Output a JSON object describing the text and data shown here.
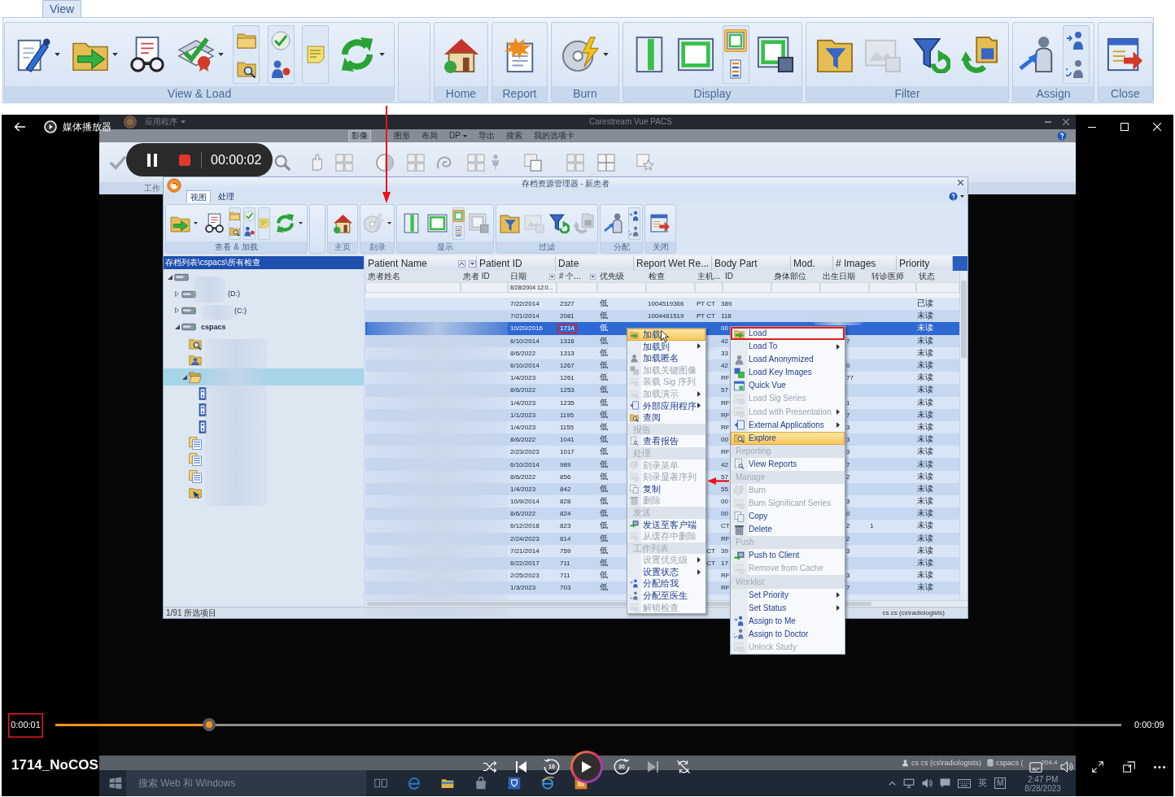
{
  "ribbon": {
    "tabs": [
      {
        "label": "View",
        "selected": true
      }
    ],
    "groups": [
      {
        "kind": "group",
        "label": "View & Load",
        "buttons": [
          {
            "kind": "large",
            "dropdown": true,
            "disabled": false
          },
          {
            "kind": "large",
            "dropdown": true,
            "disabled": false
          },
          {
            "kind": "large",
            "dropdown": false,
            "disabled": false
          },
          {
            "kind": "large",
            "dropdown": true,
            "disabled": false
          },
          {
            "kind": "stack",
            "buttons": [
              {
                "selected": false,
                "disabled": false
              },
              {
                "selected": false,
                "disabled": false
              }
            ]
          },
          {
            "kind": "stack",
            "buttons": [
              {
                "selected": false,
                "disabled": false
              },
              {
                "selected": false,
                "disabled": false
              }
            ]
          },
          {
            "kind": "stack",
            "buttons": [
              {
                "selected": false,
                "disabled": false
              }
            ]
          },
          {
            "kind": "large",
            "dropdown": true,
            "disabled": false
          }
        ]
      },
      {
        "kind": "spacer"
      },
      {
        "kind": "group",
        "label": "Home",
        "buttons": [
          {
            "kind": "large",
            "dropdown": false,
            "disabled": false
          }
        ]
      },
      {
        "kind": "group",
        "label": "Report",
        "buttons": [
          {
            "kind": "large",
            "dropdown": false,
            "disabled": false
          }
        ]
      },
      {
        "kind": "group",
        "label": "Burn",
        "buttons": [
          {
            "kind": "large",
            "dropdown": true,
            "disabled": false
          }
        ]
      },
      {
        "kind": "group",
        "label": "Display",
        "buttons": [
          {
            "kind": "large",
            "dropdown": false,
            "disabled": false
          },
          {
            "kind": "large",
            "dropdown": false,
            "disabled": false
          },
          {
            "kind": "stack",
            "buttons": [
              {
                "selected": true,
                "disabled": false
              },
              {
                "selected": false,
                "disabled": false
              }
            ]
          },
          {
            "kind": "large",
            "dropdown": false,
            "disabled": false
          }
        ]
      },
      {
        "kind": "group",
        "label": "Filter",
        "buttons": [
          {
            "kind": "large",
            "dropdown": false,
            "disabled": false
          },
          {
            "kind": "large",
            "dropdown": false,
            "disabled": true
          },
          {
            "kind": "large",
            "dropdown": false,
            "disabled": false
          },
          {
            "kind": "large",
            "dropdown": false,
            "disabled": false
          }
        ]
      },
      {
        "kind": "group",
        "label": "Assign",
        "buttons": [
          {
            "kind": "large",
            "dropdown": false,
            "disabled": false
          },
          {
            "kind": "stack",
            "buttons": [
              {
                "selected": false,
                "disabled": false
              },
              {
                "selected": false,
                "disabled": false
              }
            ]
          }
        ]
      },
      {
        "kind": "group",
        "label": "Close",
        "buttons": [
          {
            "kind": "large",
            "dropdown": false,
            "disabled": false
          }
        ]
      }
    ]
  },
  "annotation_arrows": [
    {
      "kind": "down"
    },
    {
      "kind": "left"
    }
  ],
  "player": {
    "title": "媒体播放器",
    "file_name": "1714_NoCOS",
    "elapsed": {
      "text": "0:00:01",
      "boxed": true
    },
    "total": "0:00:09",
    "level": 0.144,
    "playing": false,
    "skip_back": "10",
    "skip_forward": "30",
    "next_disabled": true
  },
  "video": {
    "app": {
      "menu": "应用程序",
      "title": "Carestream Vue PACS",
      "tabs": [
        {
          "label": "影像",
          "selected": true,
          "dropdown": false
        },
        {
          "label": "图形",
          "selected": false,
          "dropdown": false
        },
        {
          "label": "布局",
          "selected": false,
          "dropdown": false
        },
        {
          "label": "DP",
          "selected": false,
          "dropdown": true
        },
        {
          "label": "导出",
          "selected": false,
          "dropdown": false
        },
        {
          "label": "搜索",
          "selected": false,
          "dropdown": false
        },
        {
          "label": "我的选项卡",
          "selected": false,
          "dropdown": false
        }
      ],
      "group_label": "工作"
    },
    "recorder": {
      "time": "00:00:02"
    },
    "archive": {
      "title": "存档资源管理器 - 新患者",
      "tabs": [
        {
          "label": "视图",
          "selected": true
        },
        {
          "label": "处理",
          "selected": false
        }
      ],
      "ribbon": [
        {
          "kind": "group",
          "label": "查看 & 加载",
          "buttons": [
            {
              "kind": "large",
              "dropdown": true,
              "disabled": false
            },
            {
              "kind": "large",
              "dropdown": false,
              "disabled": false
            },
            {
              "kind": "stack",
              "buttons": [
                {
                  "selected": false,
                  "disabled": false
                },
                {
                  "selected": false,
                  "disabled": false
                }
              ]
            },
            {
              "kind": "stack",
              "buttons": [
                {
                  "selected": false,
                  "disabled": false
                },
                {
                  "selected": false,
                  "disabled": false
                }
              ]
            },
            {
              "kind": "stack",
              "buttons": [
                {
                  "selected": false,
                  "disabled": false
                }
              ]
            },
            {
              "kind": "large",
              "dropdown": true,
              "disabled": false
            }
          ]
        },
        {
          "kind": "spacer"
        },
        {
          "kind": "group",
          "label": "主页",
          "buttons": [
            {
              "kind": "large",
              "dropdown": false,
              "disabled": false
            }
          ]
        },
        {
          "kind": "group",
          "label": "刻录",
          "buttons": [
            {
              "kind": "large",
              "dropdown": true,
              "disabled": true
            }
          ]
        },
        {
          "kind": "group",
          "label": "显示",
          "buttons": [
            {
              "kind": "large",
              "dropdown": false,
              "disabled": false
            },
            {
              "kind": "large",
              "dropdown": false,
              "disabled": false
            },
            {
              "kind": "stack",
              "buttons": [
                {
                  "selected": true,
                  "disabled": false
                },
                {
                  "selected": false,
                  "disabled": false
                }
              ]
            },
            {
              "kind": "large",
              "dropdown": false,
              "disabled": true
            }
          ]
        },
        {
          "kind": "group",
          "label": "过滤",
          "buttons": [
            {
              "kind": "large",
              "dropdown": false,
              "disabled": false
            },
            {
              "kind": "large",
              "dropdown": false,
              "disabled": true
            },
            {
              "kind": "large",
              "dropdown": false,
              "disabled": false
            },
            {
              "kind": "large",
              "dropdown": false,
              "disabled": true
            }
          ]
        },
        {
          "kind": "group",
          "label": "分配",
          "buttons": [
            {
              "kind": "large",
              "dropdown": false,
              "disabled": false
            },
            {
              "kind": "stack",
              "buttons": [
                {
                  "selected": false,
                  "disabled": false
                },
                {
                  "selected": false,
                  "disabled": false
                }
              ]
            }
          ]
        },
        {
          "kind": "group",
          "label": "关闭",
          "buttons": [
            {
              "kind": "large",
              "dropdown": false,
              "disabled": false
            }
          ]
        }
      ],
      "tree": {
        "header": "存档列表\\cspacs\\所有检查",
        "items": [
          {
            "kind": "drive",
            "expanded": true,
            "selected": false,
            "children": [
              {
                "kind": "drive",
                "label": "(D:)",
                "expanded": false,
                "selected": false
              },
              {
                "kind": "drive",
                "label": "(C:)",
                "expanded": false,
                "selected": false
              },
              {
                "kind": "server",
                "label": "cspacs",
                "expanded": true,
                "selected": false,
                "children": [
                  {
                    "kind": "search",
                    "selected": false
                  },
                  {
                    "kind": "patient",
                    "selected": false
                  },
                  {
                    "kind": "folder",
                    "expanded": true,
                    "selected": true,
                    "children": [
                      {
                        "kind": "series",
                        "selected": false
                      },
                      {
                        "kind": "series",
                        "selected": false
                      },
                      {
                        "kind": "series",
                        "selected": false
                      }
                    ]
                  },
                  {
                    "kind": "list",
                    "selected": false
                  },
                  {
                    "kind": "list",
                    "selected": false
                  },
                  {
                    "kind": "list",
                    "selected": false
                  },
                  {
                    "kind": "import",
                    "selected": false
                  }
                ]
              }
            ]
          }
        ]
      },
      "table": {
        "columns": [
          "Patient Name",
          "Patient ID",
          "Date",
          "Report Wet Re...",
          "Body Part",
          "Mod.",
          "# Images",
          "Priority"
        ],
        "subcolumns": [
          "患者姓名",
          "患者 ID",
          "日期",
          "# 个...",
          "优先级",
          "检查",
          "主机...",
          "ID",
          "身体部位",
          "出生日期",
          "转诊医师",
          "状态"
        ],
        "date_filter": "8/28/2004 12:0...",
        "rows": [
          {
            "selected": false,
            "date": "7/22/2014",
            "count": {
              "text": "2327",
              "boxed": false
            },
            "priority": "低",
            "exam": "1004519366",
            "host": "PT CT",
            "id": "389",
            "status": "已读"
          },
          {
            "selected": false,
            "date": "7/21/2014",
            "count": {
              "text": "2081",
              "boxed": false
            },
            "priority": "低",
            "exam": "1004461519",
            "host": "PT CT",
            "id": "118",
            "status": "未读"
          },
          {
            "selected": true,
            "date": "10/20/2016",
            "count": {
              "text": "1714",
              "boxed": true
            },
            "priority": "低",
            "id": "00",
            "status": "未读"
          },
          {
            "selected": false,
            "date": "6/10/2014",
            "count": {
              "text": "1316",
              "boxed": false
            },
            "priority": "低",
            "id": "42",
            "birth": "7",
            "status": "未读"
          },
          {
            "selected": false,
            "date": "8/6/2022",
            "count": {
              "text": "1313",
              "boxed": false
            },
            "priority": "低",
            "id": "33",
            "status": "未读"
          },
          {
            "selected": false,
            "date": "6/10/2014",
            "count": {
              "text": "1267",
              "boxed": false
            },
            "priority": "低",
            "id": "42",
            "birth": "0",
            "status": "未读"
          },
          {
            "selected": false,
            "date": "1/4/2023",
            "count": {
              "text": "1261",
              "boxed": false
            },
            "priority": "低",
            "id": "RF",
            "birth": "77",
            "status": "未读"
          },
          {
            "selected": false,
            "date": "8/6/2022",
            "count": {
              "text": "1253",
              "boxed": false
            },
            "priority": "低",
            "id": "57",
            "status": "未读"
          },
          {
            "selected": false,
            "date": "1/4/2023",
            "count": {
              "text": "1235",
              "boxed": false
            },
            "priority": "低",
            "id": "RF",
            "birth": "1",
            "status": "未读"
          },
          {
            "selected": false,
            "date": "1/1/2023",
            "count": {
              "text": "1195",
              "boxed": false
            },
            "priority": "低",
            "id": "RF",
            "birth": "7",
            "status": "未读"
          },
          {
            "selected": false,
            "date": "1/4/2023",
            "count": {
              "text": "1155",
              "boxed": false
            },
            "priority": "低",
            "id": "RF",
            "birth": "3",
            "status": "未读"
          },
          {
            "selected": false,
            "date": "8/6/2022",
            "count": {
              "text": "1041",
              "boxed": false
            },
            "priority": "低",
            "id": "00",
            "birth": "3",
            "status": "未读"
          },
          {
            "selected": false,
            "date": "2/23/2023",
            "count": {
              "text": "1017",
              "boxed": false
            },
            "priority": "低",
            "id": "RF",
            "birth": "3",
            "status": "未读"
          },
          {
            "selected": false,
            "date": "6/10/2014",
            "count": {
              "text": "989",
              "boxed": false
            },
            "priority": "低",
            "id": "42",
            "birth": "7",
            "status": "未读"
          },
          {
            "selected": false,
            "date": "8/6/2022",
            "count": {
              "text": "856",
              "boxed": false
            },
            "priority": "低",
            "id": "57",
            "birth": "2",
            "status": "未读"
          },
          {
            "selected": false,
            "date": "1/4/2023",
            "count": {
              "text": "842",
              "boxed": false
            },
            "priority": "低",
            "id": "55",
            "status": "未读"
          },
          {
            "selected": false,
            "date": "10/9/2014",
            "count": {
              "text": "828",
              "boxed": false
            },
            "priority": "低",
            "id": "00",
            "birth": "3",
            "status": "未读"
          },
          {
            "selected": false,
            "date": "8/6/2022",
            "count": {
              "text": "824",
              "boxed": false
            },
            "priority": "低",
            "id": "00",
            "birth": "0",
            "status": "未读"
          },
          {
            "selected": false,
            "date": "6/12/2018",
            "count": {
              "text": "823",
              "boxed": false
            },
            "priority": "低",
            "id": "CT",
            "birth": "2",
            "referrer": "1",
            "status": "未读"
          },
          {
            "selected": false,
            "date": "2/24/2023",
            "count": {
              "text": "814",
              "boxed": false
            },
            "priority": "低",
            "id": "RF",
            "birth": "2",
            "status": "未读"
          },
          {
            "selected": false,
            "date": "7/21/2014",
            "count": {
              "text": "759",
              "boxed": false
            },
            "priority": "低",
            "host": "CT",
            "id": "39",
            "birth": "3",
            "status": "未读"
          },
          {
            "selected": false,
            "date": "6/22/2017",
            "count": {
              "text": "711",
              "boxed": false
            },
            "priority": "低",
            "host": "CT",
            "id": "17",
            "status": "未读"
          },
          {
            "selected": false,
            "date": "2/25/2023",
            "count": {
              "text": "711",
              "boxed": false
            },
            "priority": "低",
            "id": "RF",
            "birth": "3",
            "status": "未读"
          },
          {
            "selected": false,
            "date": "1/3/2023",
            "count": {
              "text": "703",
              "boxed": false
            },
            "priority": "低",
            "id": "RF",
            "birth": "7",
            "status": "未读"
          }
        ]
      },
      "status": [
        "1/91 所选项目",
        "cs cs (cs\\radiologists)"
      ]
    },
    "menus": [
      {
        "items": [
          {
            "kind": "item",
            "label": "加载",
            "disabled": false,
            "selected": true,
            "submenu": false
          },
          {
            "kind": "item",
            "label": "加载到",
            "disabled": false,
            "selected": false,
            "submenu": true
          },
          {
            "kind": "item",
            "label": "加载匿名",
            "disabled": false,
            "selected": false,
            "submenu": false
          },
          {
            "kind": "item",
            "label": "加载关键图像",
            "disabled": true,
            "selected": false,
            "submenu": false
          },
          {
            "kind": "item",
            "label": "装载 Sig 序列",
            "disabled": true,
            "selected": false,
            "submenu": false
          },
          {
            "kind": "item",
            "label": "加载演示",
            "disabled": true,
            "selected": false,
            "submenu": true
          },
          {
            "kind": "item",
            "label": "外部应用程序",
            "disabled": false,
            "selected": false,
            "submenu": true
          },
          {
            "kind": "item",
            "label": "查阅",
            "disabled": false,
            "selected": false,
            "submenu": false
          },
          {
            "kind": "section",
            "label": "报告"
          },
          {
            "kind": "item",
            "label": "查看报告",
            "disabled": false,
            "selected": false,
            "submenu": false
          },
          {
            "kind": "section",
            "label": "处理"
          },
          {
            "kind": "item",
            "label": "刻录菜单",
            "disabled": true,
            "selected": false,
            "submenu": false
          },
          {
            "kind": "item",
            "label": "刻录显著序列",
            "disabled": true,
            "selected": false,
            "submenu": false
          },
          {
            "kind": "item",
            "label": "复制",
            "disabled": false,
            "selected": false,
            "submenu": false
          },
          {
            "kind": "item",
            "label": "删除",
            "disabled": true,
            "selected": false,
            "submenu": false
          },
          {
            "kind": "section",
            "label": "发送"
          },
          {
            "kind": "item",
            "label": "发送至客户端",
            "disabled": false,
            "selected": false,
            "submenu": false
          },
          {
            "kind": "item",
            "label": "从缓存中删除",
            "disabled": true,
            "selected": false,
            "submenu": false
          },
          {
            "kind": "section",
            "label": "工作列表"
          },
          {
            "kind": "item",
            "label": "设置优先级",
            "disabled": true,
            "selected": false,
            "submenu": true
          },
          {
            "kind": "item",
            "label": "设置状态",
            "disabled": false,
            "selected": false,
            "submenu": true
          },
          {
            "kind": "item",
            "label": "分配给我",
            "disabled": false,
            "selected": false,
            "submenu": false
          },
          {
            "kind": "item",
            "label": "分配至医生",
            "disabled": false,
            "selected": false,
            "submenu": false
          },
          {
            "kind": "item",
            "label": "解锁检查",
            "disabled": true,
            "selected": false,
            "submenu": false
          }
        ]
      },
      {
        "items": [
          {
            "kind": "item",
            "label": "Load",
            "disabled": false,
            "selected": false,
            "submenu": false,
            "boxed": true
          },
          {
            "kind": "item",
            "label": "Load To",
            "disabled": false,
            "selected": false,
            "submenu": true,
            "boxed": false
          },
          {
            "kind": "item",
            "label": "Load Anonymized",
            "disabled": false,
            "selected": false,
            "submenu": false,
            "boxed": false
          },
          {
            "kind": "item",
            "label": "Load Key Images",
            "disabled": false,
            "selected": false,
            "submenu": false,
            "boxed": false
          },
          {
            "kind": "item",
            "label": "Quick Vue",
            "disabled": false,
            "selected": false,
            "submenu": false,
            "boxed": false
          },
          {
            "kind": "item",
            "label": "Load Sig Series",
            "disabled": true,
            "selected": false,
            "submenu": false,
            "boxed": false
          },
          {
            "kind": "item",
            "label": "Load with Presentation",
            "disabled": true,
            "selected": false,
            "submenu": true,
            "boxed": false
          },
          {
            "kind": "item",
            "label": "External Applications",
            "disabled": false,
            "selected": false,
            "submenu": true,
            "boxed": false
          },
          {
            "kind": "item",
            "label": "Explore",
            "disabled": false,
            "selected": true,
            "submenu": false,
            "boxed": false
          },
          {
            "kind": "section",
            "label": "Reporting"
          },
          {
            "kind": "item",
            "label": "View Reports",
            "disabled": false,
            "selected": false,
            "submenu": false,
            "boxed": false
          },
          {
            "kind": "section",
            "label": "Manage"
          },
          {
            "kind": "item",
            "label": "Burn",
            "disabled": true,
            "selected": false,
            "submenu": false,
            "boxed": false
          },
          {
            "kind": "item",
            "label": "Burn Significant Series",
            "disabled": true,
            "selected": false,
            "submenu": false,
            "boxed": false
          },
          {
            "kind": "item",
            "label": "Copy",
            "disabled": false,
            "selected": false,
            "submenu": false,
            "boxed": false
          },
          {
            "kind": "item",
            "label": "Delete",
            "disabled": false,
            "selected": false,
            "submenu": false,
            "boxed": false
          },
          {
            "kind": "section",
            "label": "Push"
          },
          {
            "kind": "item",
            "label": "Push to Client",
            "disabled": false,
            "selected": false,
            "submenu": false,
            "boxed": false
          },
          {
            "kind": "item",
            "label": "Remove from Cache",
            "disabled": true,
            "selected": false,
            "submenu": false,
            "boxed": false
          },
          {
            "kind": "section",
            "label": "Worklist"
          },
          {
            "kind": "item",
            "label": "Set Priority",
            "disabled": false,
            "selected": false,
            "submenu": true,
            "boxed": false
          },
          {
            "kind": "item",
            "label": "Set Status",
            "disabled": false,
            "selected": false,
            "submenu": true,
            "boxed": false
          },
          {
            "kind": "item",
            "label": "Assign to Me",
            "disabled": false,
            "selected": false,
            "submenu": false,
            "boxed": false
          },
          {
            "kind": "item",
            "label": "Assign to Doctor",
            "disabled": false,
            "selected": false,
            "submenu": false,
            "boxed": false
          },
          {
            "kind": "item",
            "label": "Unlock Study",
            "disabled": true,
            "selected": false,
            "submenu": false,
            "boxed": false
          }
        ]
      }
    ],
    "status_strip": [
      "cs cs (cs\\radiologists)",
      "cspacs (",
      "204.4"
    ],
    "taskbar": {
      "search_placeholder": "搜索 Web 和 Windows",
      "ime": "英",
      "ime_mode": "M",
      "time": "2:47 PM",
      "date": "8/28/2023"
    }
  }
}
